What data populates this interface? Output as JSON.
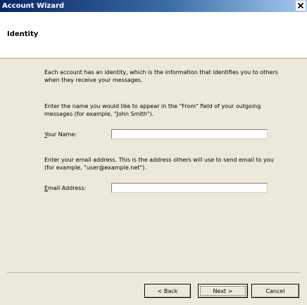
{
  "window": {
    "title": "Account Wizard"
  },
  "header": {
    "title": "Identity"
  },
  "intro": {
    "text": "Each account has an identity, which is the information that identifies you to others when they receive your messages."
  },
  "name_section": {
    "description": "Enter the name you would like to appear in the \"From\" field of your outgoing messages (for example, \"John Smith\").",
    "label_accesskey": "Y",
    "label_rest": "our Name:",
    "value": ""
  },
  "email_section": {
    "description": "Enter your email address. This is the address others will use to send email to you (for example, \"user@example.net\").",
    "label_accesskey": "E",
    "label_rest": "mail Address:",
    "value": ""
  },
  "buttons": {
    "back": "< Back",
    "next": "Next >",
    "cancel": "Cancel"
  },
  "icons": {
    "close": "close-icon"
  }
}
